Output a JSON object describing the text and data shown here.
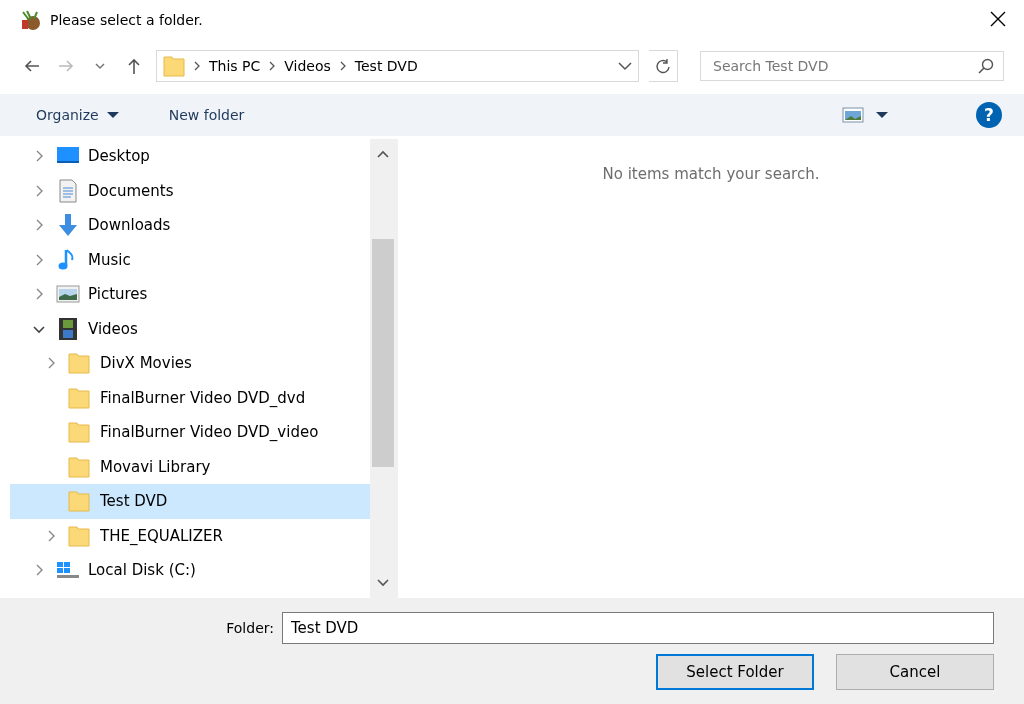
{
  "window": {
    "title": "Please select a folder."
  },
  "address": {
    "crumbs": [
      "This PC",
      "Videos",
      "Test DVD"
    ]
  },
  "search": {
    "placeholder": "Search Test DVD"
  },
  "toolbar": {
    "organize": "Organize",
    "new_folder": "New folder",
    "help": "?"
  },
  "tree": [
    {
      "label": "Desktop",
      "kind": "desktop",
      "expandable": true,
      "expanded": false,
      "selected": false
    },
    {
      "label": "Documents",
      "kind": "documents",
      "expandable": true,
      "expanded": false,
      "selected": false
    },
    {
      "label": "Downloads",
      "kind": "downloads",
      "expandable": true,
      "expanded": false,
      "selected": false
    },
    {
      "label": "Music",
      "kind": "music",
      "expandable": true,
      "expanded": false,
      "selected": false
    },
    {
      "label": "Pictures",
      "kind": "pictures",
      "expandable": true,
      "expanded": false,
      "selected": false
    },
    {
      "label": "Videos",
      "kind": "videos",
      "expandable": true,
      "expanded": true,
      "selected": false,
      "children": [
        {
          "label": "DivX Movies",
          "kind": "folder",
          "expandable": true,
          "expanded": false,
          "selected": false
        },
        {
          "label": "FinalBurner Video DVD_dvd",
          "kind": "folder",
          "expandable": false,
          "expanded": false,
          "selected": false
        },
        {
          "label": "FinalBurner Video DVD_video",
          "kind": "folder",
          "expandable": false,
          "expanded": false,
          "selected": false
        },
        {
          "label": "Movavi Library",
          "kind": "folder",
          "expandable": false,
          "expanded": false,
          "selected": false
        },
        {
          "label": "Test DVD",
          "kind": "folder",
          "expandable": false,
          "expanded": false,
          "selected": true
        },
        {
          "label": "THE_EQUALIZER",
          "kind": "folder",
          "expandable": true,
          "expanded": false,
          "selected": false
        }
      ]
    },
    {
      "label": "Local Disk (C:)",
      "kind": "drive",
      "expandable": true,
      "expanded": false,
      "selected": false
    }
  ],
  "content": {
    "message": "No items match your search."
  },
  "footer": {
    "folder_label": "Folder:",
    "folder_value": "Test DVD",
    "buttons": [
      {
        "label": "Select Folder",
        "kind": "default"
      },
      {
        "label": "Cancel",
        "kind": "normal"
      }
    ]
  }
}
